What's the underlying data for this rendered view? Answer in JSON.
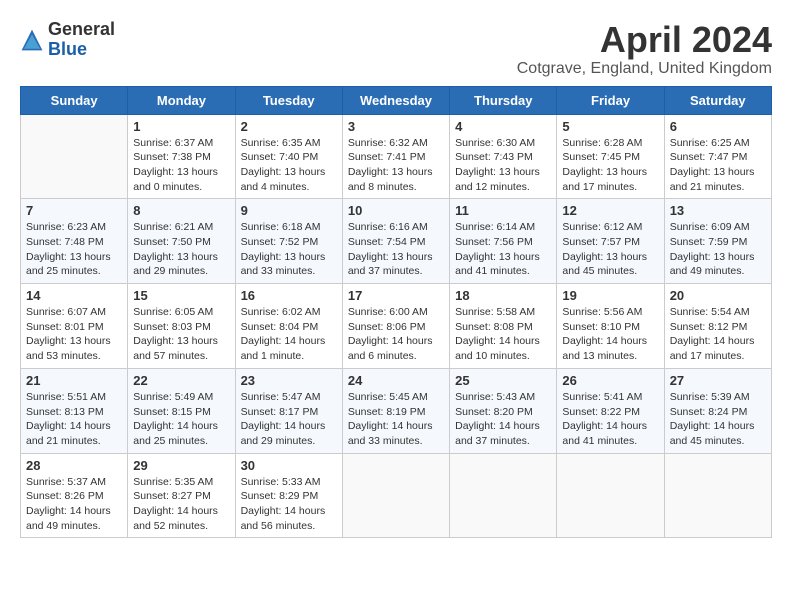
{
  "logo": {
    "general": "General",
    "blue": "Blue"
  },
  "title": "April 2024",
  "subtitle": "Cotgrave, England, United Kingdom",
  "days_of_week": [
    "Sunday",
    "Monday",
    "Tuesday",
    "Wednesday",
    "Thursday",
    "Friday",
    "Saturday"
  ],
  "weeks": [
    [
      {
        "day": "",
        "info": ""
      },
      {
        "day": "1",
        "info": "Sunrise: 6:37 AM\nSunset: 7:38 PM\nDaylight: 13 hours\nand 0 minutes."
      },
      {
        "day": "2",
        "info": "Sunrise: 6:35 AM\nSunset: 7:40 PM\nDaylight: 13 hours\nand 4 minutes."
      },
      {
        "day": "3",
        "info": "Sunrise: 6:32 AM\nSunset: 7:41 PM\nDaylight: 13 hours\nand 8 minutes."
      },
      {
        "day": "4",
        "info": "Sunrise: 6:30 AM\nSunset: 7:43 PM\nDaylight: 13 hours\nand 12 minutes."
      },
      {
        "day": "5",
        "info": "Sunrise: 6:28 AM\nSunset: 7:45 PM\nDaylight: 13 hours\nand 17 minutes."
      },
      {
        "day": "6",
        "info": "Sunrise: 6:25 AM\nSunset: 7:47 PM\nDaylight: 13 hours\nand 21 minutes."
      }
    ],
    [
      {
        "day": "7",
        "info": "Sunrise: 6:23 AM\nSunset: 7:48 PM\nDaylight: 13 hours\nand 25 minutes."
      },
      {
        "day": "8",
        "info": "Sunrise: 6:21 AM\nSunset: 7:50 PM\nDaylight: 13 hours\nand 29 minutes."
      },
      {
        "day": "9",
        "info": "Sunrise: 6:18 AM\nSunset: 7:52 PM\nDaylight: 13 hours\nand 33 minutes."
      },
      {
        "day": "10",
        "info": "Sunrise: 6:16 AM\nSunset: 7:54 PM\nDaylight: 13 hours\nand 37 minutes."
      },
      {
        "day": "11",
        "info": "Sunrise: 6:14 AM\nSunset: 7:56 PM\nDaylight: 13 hours\nand 41 minutes."
      },
      {
        "day": "12",
        "info": "Sunrise: 6:12 AM\nSunset: 7:57 PM\nDaylight: 13 hours\nand 45 minutes."
      },
      {
        "day": "13",
        "info": "Sunrise: 6:09 AM\nSunset: 7:59 PM\nDaylight: 13 hours\nand 49 minutes."
      }
    ],
    [
      {
        "day": "14",
        "info": "Sunrise: 6:07 AM\nSunset: 8:01 PM\nDaylight: 13 hours\nand 53 minutes."
      },
      {
        "day": "15",
        "info": "Sunrise: 6:05 AM\nSunset: 8:03 PM\nDaylight: 13 hours\nand 57 minutes."
      },
      {
        "day": "16",
        "info": "Sunrise: 6:02 AM\nSunset: 8:04 PM\nDaylight: 14 hours\nand 1 minute."
      },
      {
        "day": "17",
        "info": "Sunrise: 6:00 AM\nSunset: 8:06 PM\nDaylight: 14 hours\nand 6 minutes."
      },
      {
        "day": "18",
        "info": "Sunrise: 5:58 AM\nSunset: 8:08 PM\nDaylight: 14 hours\nand 10 minutes."
      },
      {
        "day": "19",
        "info": "Sunrise: 5:56 AM\nSunset: 8:10 PM\nDaylight: 14 hours\nand 13 minutes."
      },
      {
        "day": "20",
        "info": "Sunrise: 5:54 AM\nSunset: 8:12 PM\nDaylight: 14 hours\nand 17 minutes."
      }
    ],
    [
      {
        "day": "21",
        "info": "Sunrise: 5:51 AM\nSunset: 8:13 PM\nDaylight: 14 hours\nand 21 minutes."
      },
      {
        "day": "22",
        "info": "Sunrise: 5:49 AM\nSunset: 8:15 PM\nDaylight: 14 hours\nand 25 minutes."
      },
      {
        "day": "23",
        "info": "Sunrise: 5:47 AM\nSunset: 8:17 PM\nDaylight: 14 hours\nand 29 minutes."
      },
      {
        "day": "24",
        "info": "Sunrise: 5:45 AM\nSunset: 8:19 PM\nDaylight: 14 hours\nand 33 minutes."
      },
      {
        "day": "25",
        "info": "Sunrise: 5:43 AM\nSunset: 8:20 PM\nDaylight: 14 hours\nand 37 minutes."
      },
      {
        "day": "26",
        "info": "Sunrise: 5:41 AM\nSunset: 8:22 PM\nDaylight: 14 hours\nand 41 minutes."
      },
      {
        "day": "27",
        "info": "Sunrise: 5:39 AM\nSunset: 8:24 PM\nDaylight: 14 hours\nand 45 minutes."
      }
    ],
    [
      {
        "day": "28",
        "info": "Sunrise: 5:37 AM\nSunset: 8:26 PM\nDaylight: 14 hours\nand 49 minutes."
      },
      {
        "day": "29",
        "info": "Sunrise: 5:35 AM\nSunset: 8:27 PM\nDaylight: 14 hours\nand 52 minutes."
      },
      {
        "day": "30",
        "info": "Sunrise: 5:33 AM\nSunset: 8:29 PM\nDaylight: 14 hours\nand 56 minutes."
      },
      {
        "day": "",
        "info": ""
      },
      {
        "day": "",
        "info": ""
      },
      {
        "day": "",
        "info": ""
      },
      {
        "day": "",
        "info": ""
      }
    ]
  ]
}
